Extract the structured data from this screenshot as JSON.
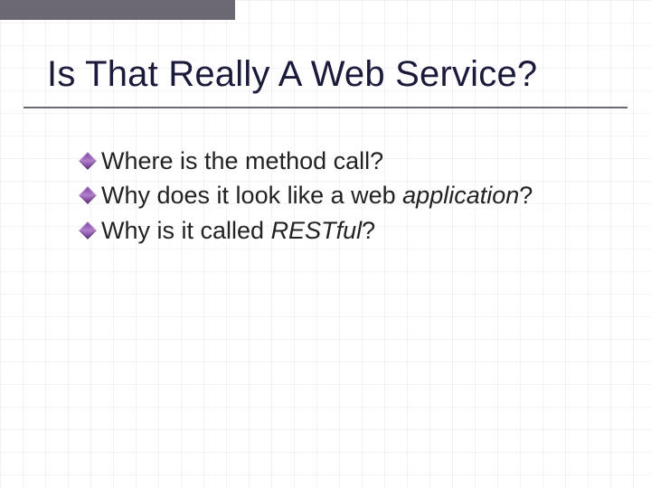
{
  "title": "Is That Really A Web Service?",
  "bullets": [
    {
      "pre": "Where is the method call?",
      "ital": "",
      "post": ""
    },
    {
      "pre": "Why does it look like a web ",
      "ital": "application",
      "post": "?"
    },
    {
      "pre": "Why is it called ",
      "ital": "RESTful",
      "post": "?"
    }
  ]
}
